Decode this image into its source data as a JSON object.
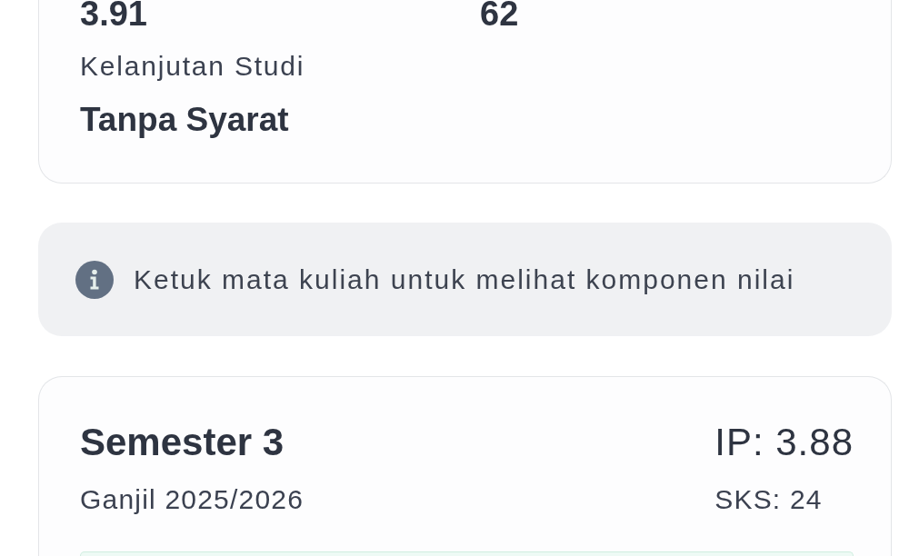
{
  "summary_card": {
    "stats": [
      {
        "value": "3.91"
      },
      {
        "value": "62"
      }
    ],
    "continuation": {
      "label": "Kelanjutan Studi",
      "value": "Tanpa Syarat"
    }
  },
  "info_banner": {
    "text": "Ketuk mata kuliah untuk melihat komponen nilai"
  },
  "semesters": [
    {
      "title": "Semester 3",
      "term": "Ganjil 2025/2026",
      "ip": "IP: 3.88",
      "sks": "SKS: 24"
    }
  ]
}
